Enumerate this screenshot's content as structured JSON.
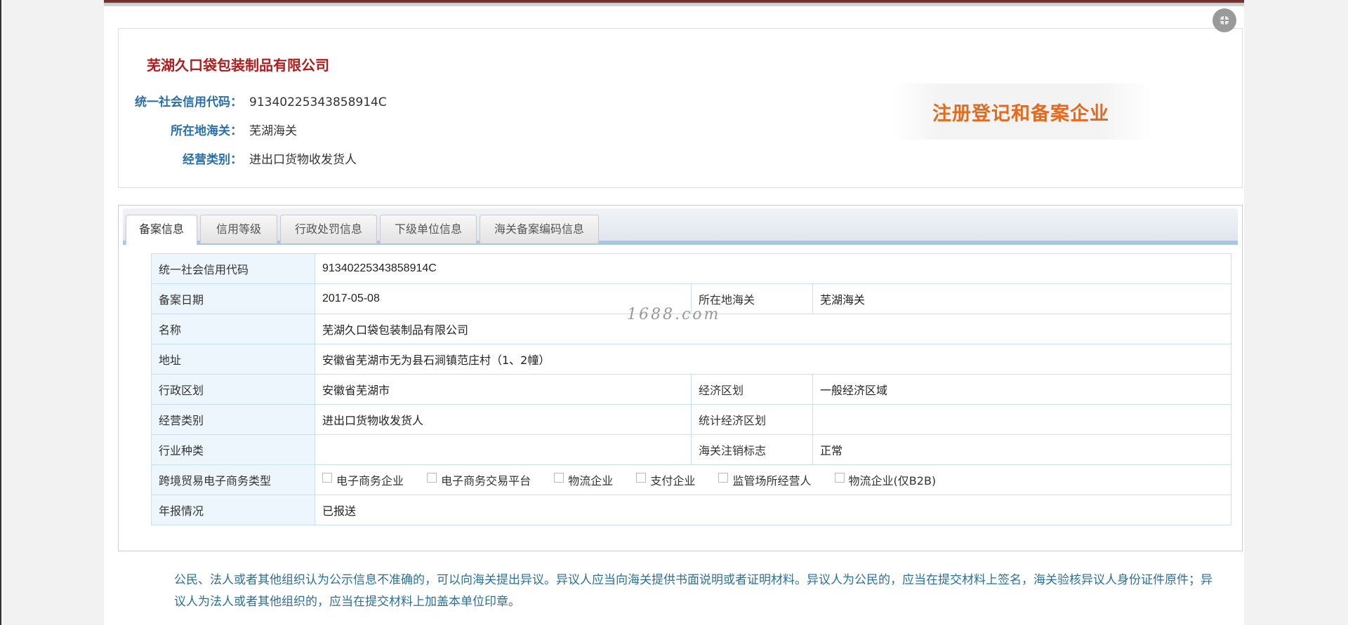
{
  "company": {
    "name": "芜湖久口袋包装制品有限公司",
    "credit_code_label": "统一社会信用代码：",
    "credit_code": "91340225343858914C",
    "customs_label": "所在地海关：",
    "customs": "芜湖海关",
    "business_type_label": "经营类别：",
    "business_type": "进出口货物收发货人",
    "badge": "注册登记和备案企业"
  },
  "tabs": [
    {
      "label": "备案信息",
      "active": true
    },
    {
      "label": "信用等级",
      "active": false
    },
    {
      "label": "行政处罚信息",
      "active": false
    },
    {
      "label": "下级单位信息",
      "active": false
    },
    {
      "label": "海关备案编码信息",
      "active": false
    }
  ],
  "table": {
    "credit_code_k": "统一社会信用代码",
    "credit_code_v": "91340225343858914C",
    "reg_date_k": "备案日期",
    "reg_date_v": "2017-05-08",
    "customs_k": "所在地海关",
    "customs_v": "芜湖海关",
    "name_k": "名称",
    "name_v": "芜湖久口袋包装制品有限公司",
    "address_k": "地址",
    "address_v": "安徽省芜湖市无为县石涧镇范庄村（1、2幢）",
    "admin_k": "行政区划",
    "admin_v": "安徽省芜湖市",
    "econ_k": "经济区划",
    "econ_v": "一般经济区域",
    "biz_type_k": "经营类别",
    "biz_type_v": "进出口货物收发货人",
    "stat_k": "统计经济区划",
    "stat_v": "",
    "industry_k": "行业种类",
    "industry_v": "",
    "cancel_k": "海关注销标志",
    "cancel_v": "正常",
    "ecom_k": "跨境贸易电子商务类型",
    "ecom_options": [
      "电子商务企业",
      "电子商务交易平台",
      "物流企业",
      "支付企业",
      "监管场所经营人",
      "物流企业(仅B2B)"
    ],
    "annual_k": "年报情况",
    "annual_v": "已报送"
  },
  "watermark": "1688.com",
  "notice": "公民、法人或者其他组织认为公示信息不准确的，可以向海关提出异议。异议人应当向海关提供书面说明或者证明材料。异议人为公民的，应当在提交材料上签名，海关验核异议人身份证件原件；异议人为法人或者其他组织的，应当在提交材料上加盖本单位印章。"
}
